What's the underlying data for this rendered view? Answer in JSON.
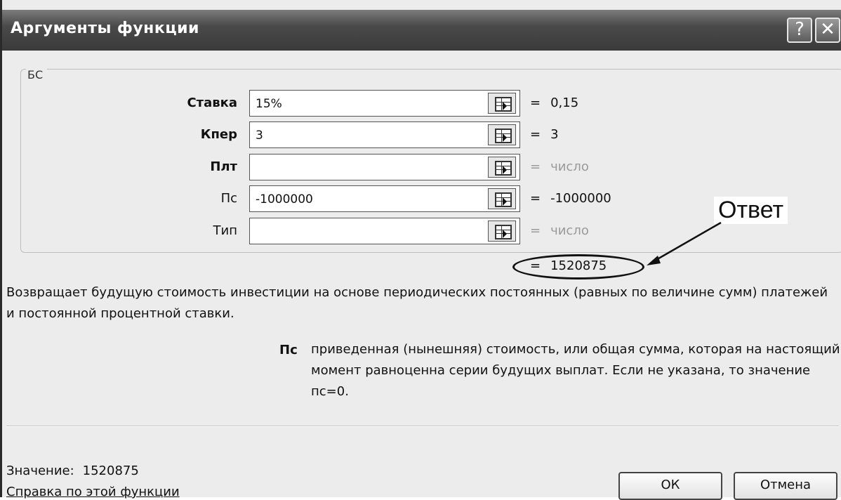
{
  "dialog": {
    "title": "Аргументы функции",
    "help_button": "?",
    "close_button": "✕"
  },
  "function": {
    "name": "БС",
    "arguments": [
      {
        "label": "Ставка",
        "value": "15%",
        "result": "0,15",
        "bold": true,
        "placeholder_result": false
      },
      {
        "label": "Кпер",
        "value": "3",
        "result": "3",
        "bold": true,
        "placeholder_result": false
      },
      {
        "label": "Плт",
        "value": "",
        "result": "число",
        "bold": true,
        "placeholder_result": true
      },
      {
        "label": "Пс",
        "value": "-1000000",
        "result": "-1000000",
        "bold": false,
        "placeholder_result": false
      },
      {
        "label": "Тип",
        "value": "",
        "result": "число",
        "bold": false,
        "placeholder_result": true
      }
    ],
    "result_eq": "=",
    "result": "1520875",
    "description": "Возвращает будущую стоимость инвестиции на основе периодических постоянных (равных по величине сумм) платежей и постоянной процентной ставки.",
    "param_name": "Пс",
    "param_description": "приведенная (нынешняя) стоимость, или общая сумма, которая на настоящий момент равноценна серии будущих выплат. Если не указана, то значение пс=0."
  },
  "annotation": {
    "label": "Ответ"
  },
  "footer": {
    "value_label": "Значение:",
    "value": "1520875",
    "help_link": "Справка по этой функции",
    "ok_label": "ОК",
    "cancel_label": "Отмена"
  }
}
